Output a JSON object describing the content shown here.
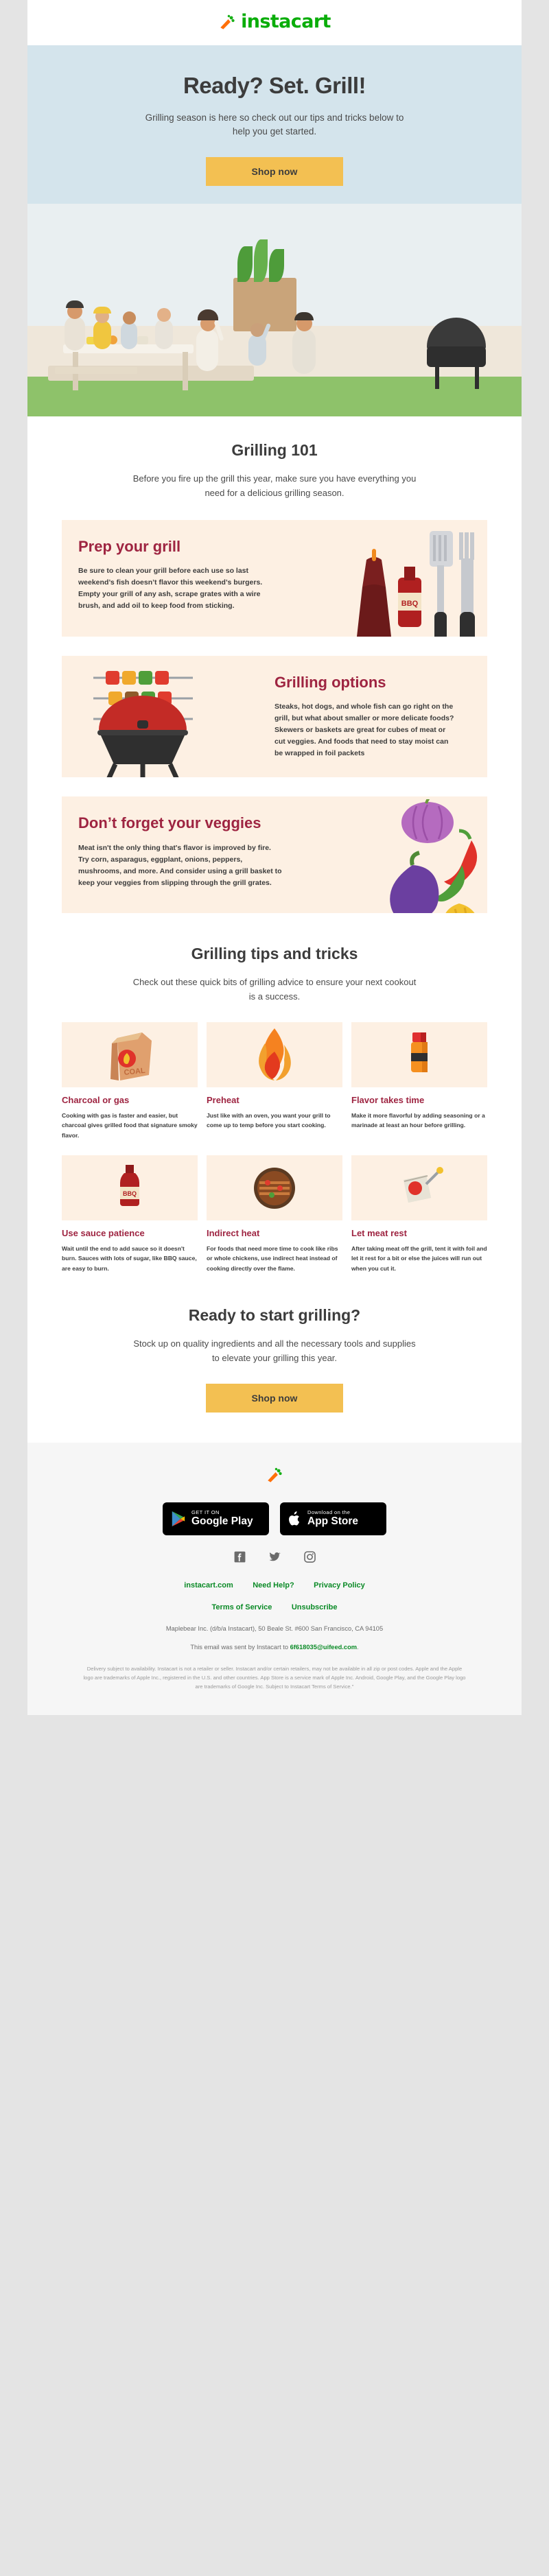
{
  "brand": {
    "name": "instacart",
    "green": "#0AAD0A",
    "orange": "#FF7009",
    "yellow": "#F3C052",
    "maroon": "#9E2441",
    "hero_bg": "#D4E4EC",
    "card_bg": "#FDF0E3"
  },
  "hero": {
    "title": "Ready? Set. Grill!",
    "subtitle": "Grilling season is here so check out our tips and tricks below to help you get started.",
    "cta_label": "Shop now",
    "image_alt": "family-bbq-backyard-illustration"
  },
  "grilling101": {
    "title": "Grilling 101",
    "subtitle": "Before you fire up the grill this year, make sure you have everything you need for a delicious grilling season.",
    "cards": [
      {
        "heading": "Prep your grill",
        "body": "Be sure to clean your grill before each use so last weekend’s fish doesn’t flavor this weekend’s burgers. Empty your grill of any ash, scrape grates with a wire brush, and add oil to keep food from sticking.",
        "art": "grill-tools-spatula-fork-bbq-sauce",
        "align": "left"
      },
      {
        "heading": "Grilling options",
        "body": "Steaks, hot dogs, and whole fish can go right on the grill, but what about smaller or more delicate foods? Skewers or baskets are great for cubes of meat or cut veggies. And foods that need to stay moist can be wrapped in foil packets",
        "art": "kettle-grill-with-skewers",
        "align": "right"
      },
      {
        "heading": "Don’t forget your veggies",
        "body": "Meat isn't the only thing that's flavor is improved by fire. Try corn, asparagus, eggplant, onions, peppers, mushrooms, and more. And consider using a grill basket to keep your veggies from slipping through the grill grates.",
        "art": "onion-chili-eggplant-corn",
        "align": "left"
      }
    ]
  },
  "tips": {
    "title": "Grilling tips and tricks",
    "subtitle": "Check out these quick bits of grilling advice to ensure your next cookout is a success.",
    "items": [
      {
        "icon": "charcoal-bag-icon",
        "heading": "Charcoal or gas",
        "body": "Cooking with gas is faster and easier, but charcoal gives grilled food that signature smoky flavor."
      },
      {
        "icon": "flame-icon",
        "heading": "Preheat",
        "body": "Just like with an oven, you want your grill to come up to temp before you start cooking."
      },
      {
        "icon": "seasoning-bottle-icon",
        "heading": "Flavor takes time",
        "body": "Make it more flavorful by adding seasoning or a marinade at least an hour before grilling."
      },
      {
        "icon": "bbq-sauce-bottle-icon",
        "heading": "Use sauce patience",
        "body": "Wait until the end to add sauce so it doesn't burn. Sauces with lots of sugar, like BBQ sauce, are easy to burn."
      },
      {
        "icon": "grill-grate-icon",
        "heading": "Indirect heat",
        "body": "For foods that need more time to cook like ribs or whole chickens, use indirect heat instead of cooking directly over the flame."
      },
      {
        "icon": "meat-thermometer-icon",
        "heading": "Let meat rest",
        "body": "After taking meat off the grill, tent it with foil and let it rest for a bit or else the juices will run out when you cut it."
      }
    ]
  },
  "cta": {
    "title": "Ready to start grilling?",
    "subtitle": "Stock up on quality ingredients and all the necessary tools and supplies to elevate your grilling this year.",
    "button_label": "Shop now"
  },
  "footer": {
    "carrot_icon": "carrot-icon",
    "badges": [
      {
        "name": "google-play-badge",
        "small": "GET IT ON",
        "big": "Google Play"
      },
      {
        "name": "app-store-badge",
        "small": "Download on the",
        "big": "App Store"
      }
    ],
    "socials": [
      "facebook-icon",
      "twitter-icon",
      "instagram-icon"
    ],
    "links_row1": [
      "instacart.com",
      "Need Help?",
      "Privacy Policy"
    ],
    "links_row2": [
      "Terms of Service",
      "Unsubscribe"
    ],
    "address": "Maplebear Inc. (d/b/a Instacart), 50 Beale St. #600 San Francisco, CA 94105",
    "sent_to_prefix": "This email was sent by Instacart to ",
    "sent_to_email": "6f618035@uifeed.com",
    "sent_to_suffix": ".",
    "legal": "Delivery subject to availability. Instacart is not a retailer or seller. Instacart and/or certain retailers, may not be available in all zip or post codes. Apple and the Apple logo are trademarks of Apple Inc., registered in the U.S. and other countries. App Store is a service mark of Apple Inc. Android, Google Play, and the Google Play logo are trademarks of Google Inc. Subject to Instacart Terms of Service.\""
  }
}
